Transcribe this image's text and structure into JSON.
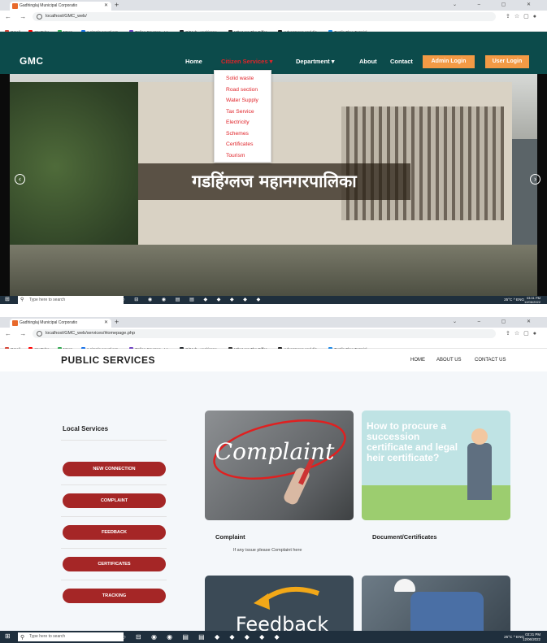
{
  "browser1": {
    "tab_title": "Gadhinglaj Municipal Corporatio",
    "url": "localhost/GMC_web/",
    "bookmarks": [
      "Gmail",
      "YouTube",
      "Maps",
      "A simple newsl.net...",
      "Online Courses - Le...",
      "GitHub - uxckicone...",
      "What Are The Differ...",
      "Advantages and dis...",
      "Textile Flow Tutorial..."
    ]
  },
  "gmc": {
    "logo": "GMC",
    "nav": {
      "home": "Home",
      "citizen": "Citizen Services",
      "department": "Department",
      "about": "About",
      "contact": "Contact"
    },
    "admin_login": "Admin Login",
    "user_login": "User Login",
    "dropdown": [
      "Solid waste",
      "Road section",
      "Water Supply",
      "Tax Service",
      "Electricity",
      "Schemes",
      "Certificates",
      "Tourism"
    ],
    "hero_title": "गडहिंग्लज महानगरपालिका"
  },
  "browser2": {
    "tab_title": "Gadhinglaj Municipal Corporatio",
    "url": "localhost/GMC_web/services/Homepage.php",
    "bookmarks": [
      "Gmail",
      "YouTube",
      "Maps",
      "A simple newsl.net...",
      "Online Courses - Le...",
      "GitHub - uxckicone...",
      "What Are The Differ...",
      "Advantages and dis...",
      "Textile Flow Tutorial..."
    ]
  },
  "ps": {
    "title": "PUBLIC SERVICES",
    "nav": {
      "home": "HOME",
      "about": "ABOUT US",
      "contact": "CONTACT US"
    },
    "sidebar_heading": "Local Services",
    "buttons": [
      "NEW CONNECTION",
      "COMPLAINT",
      "FEEDBACK",
      "CERTIFICATES",
      "TRACKING"
    ],
    "cards": [
      {
        "title": "Complaint",
        "desc": "If any issue please Complaint here",
        "image_text": "Complaint"
      },
      {
        "title": "Document/Certificates",
        "desc": "",
        "image_text": "How to procure a succession certificate and legal heir certificate?"
      },
      {
        "title": "",
        "desc": "",
        "image_text": "Feedback"
      },
      {
        "title": "",
        "desc": "",
        "image_text": ""
      }
    ]
  },
  "taskbar": {
    "search_placeholder": "Type here to search",
    "tray": "25°C  ^  ENG",
    "time": "03:31 PM",
    "date": "12/06/2022"
  },
  "colors": {
    "gmc_nav": "#0c4b4b",
    "login_btn": "#f39a45",
    "dropdown_text": "#e0242a",
    "pill": "#a52626"
  }
}
